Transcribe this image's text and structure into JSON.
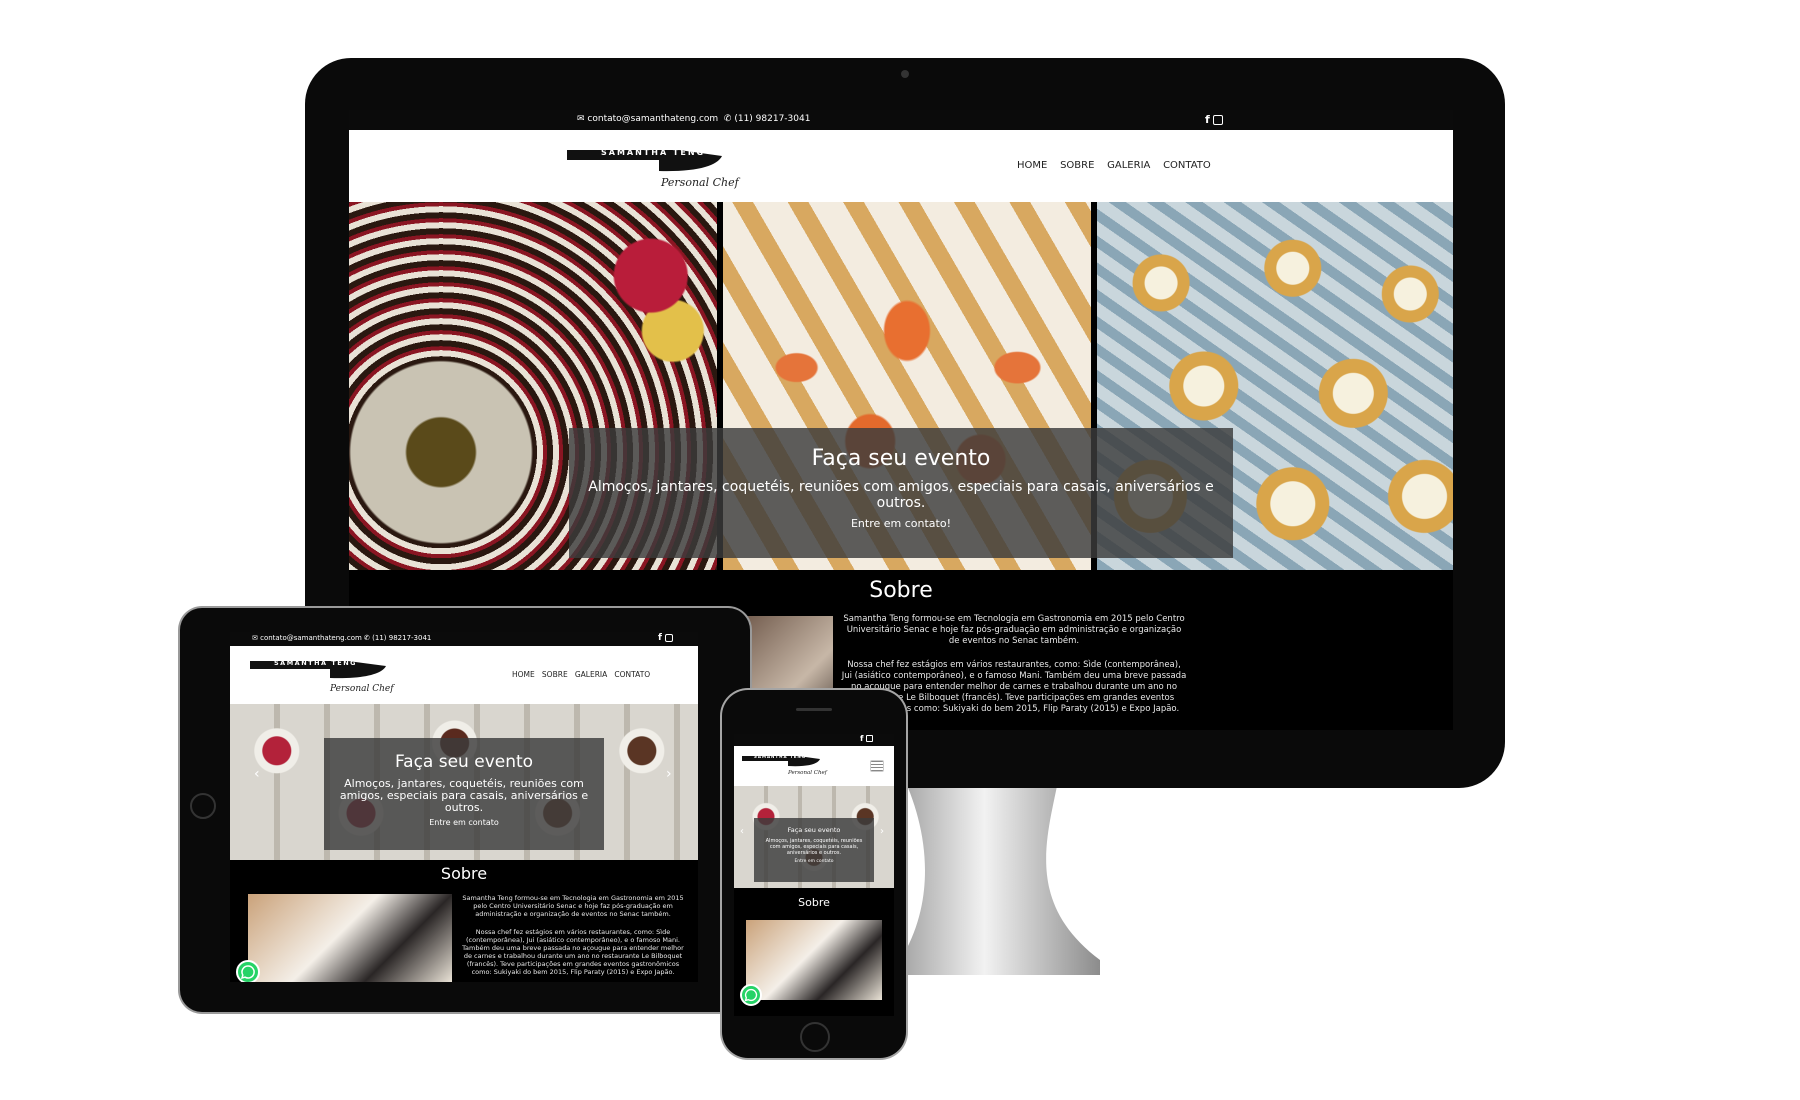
{
  "topbar": {
    "email": "contato@samanthateng.com",
    "phone": "(11) 98217-3041",
    "social": [
      "facebook-icon",
      "instagram-icon"
    ]
  },
  "brand": {
    "name": "SAMANTHA TENG",
    "tagline": "Personal Chef"
  },
  "nav": [
    "HOME",
    "SOBRE",
    "GALERIA",
    "CONTATO"
  ],
  "hero": {
    "title": "Faça seu evento",
    "subtitle": "Almoços, jantares, coquetéis, reuniões com amigos, especiais para casais, aniversários e outros.",
    "cta": "Entre em contato!",
    "cta_tablet": "Entre em contato"
  },
  "sobre": {
    "title": "Sobre",
    "p1": "Samantha Teng formou-se em Tecnologia em Gastronomia em 2015 pelo Centro Universitário Senac e hoje faz pós-graduação em administração e organização de eventos no Senac também.",
    "p2": "Nossa chef fez estágios em vários restaurantes, como: Sìde (contemporânea), Jui (asiático contemporâneo), e o famoso Mani. Também deu uma breve passada no açougue para entender melhor de carnes e trabalhou durante um ano no restaurante Le Bilboquet (francês). Teve participações em grandes eventos gastronômicos como: Sukiyaki do bem 2015, Flip Paraty (2015) e Expo Japão."
  },
  "colors": {
    "accent_whatsapp": "#25d366",
    "device_bezel": "#0a0a0a",
    "site_black": "#000000"
  }
}
